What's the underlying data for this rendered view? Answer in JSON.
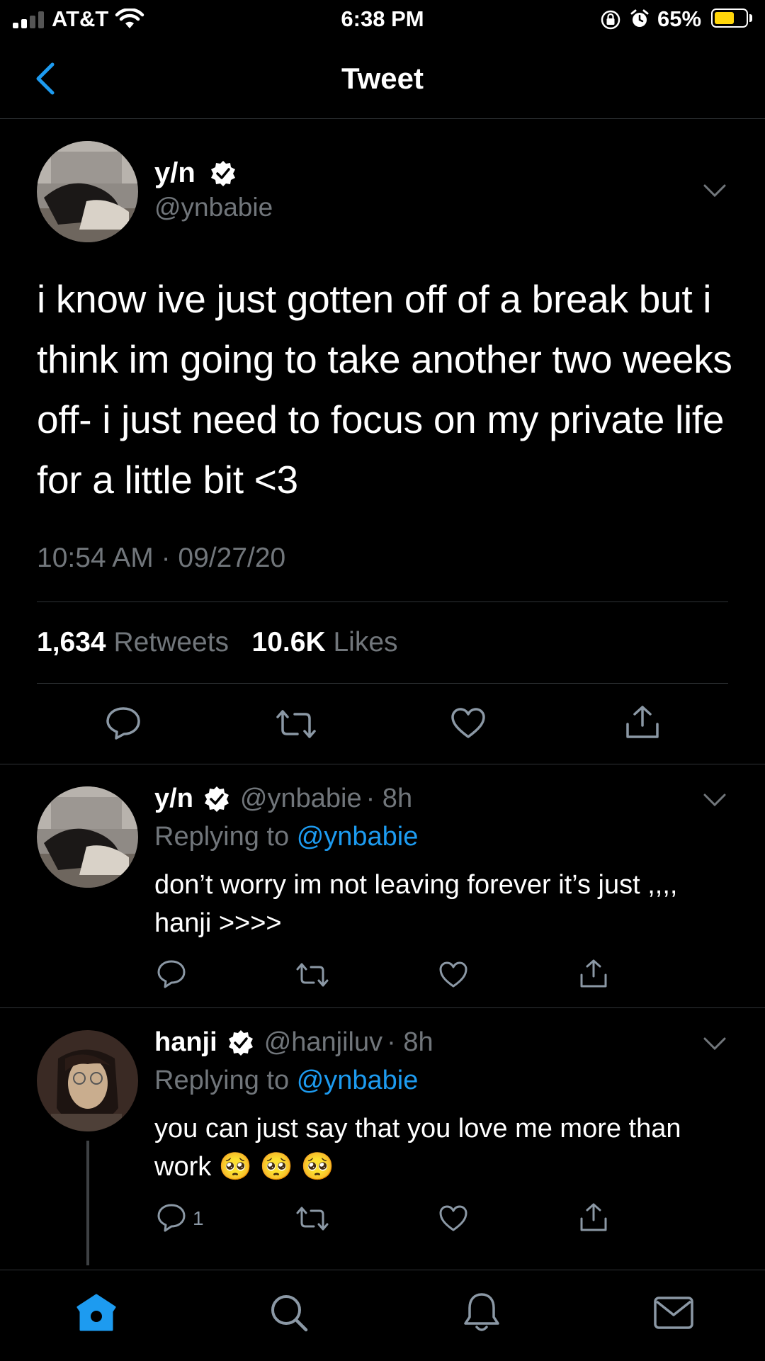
{
  "status_bar": {
    "carrier": "AT&T",
    "time": "6:38 PM",
    "battery_percent": "65%",
    "battery_level": 0.65,
    "battery_color": "#ffd60a"
  },
  "header": {
    "title": "Tweet",
    "back_icon": "chevron-left-icon"
  },
  "main_tweet": {
    "name": "y/n",
    "handle": "@ynbabie",
    "text": "i know ive just gotten off of a break but i think im going to take another two weeks off- i just need to focus on my private life for a little bit <3",
    "timestamp": "10:54 AM · 09/27/20",
    "retweets_count": "1,634",
    "retweets_label": "Retweets",
    "likes_count": "10.6K",
    "likes_label": "Likes"
  },
  "replies": [
    {
      "name": "y/n",
      "handle": "@ynbabie",
      "time": "· 8h",
      "replying_label": "Replying to",
      "replying_to": "@ynbabie",
      "text": "don’t worry im not leaving forever it’s just ,,,, hanji >>>>",
      "reply_count": ""
    },
    {
      "name": "hanji",
      "handle": "@hanjiluv",
      "time": "· 8h",
      "replying_label": "Replying to",
      "replying_to": "@ynbabie",
      "text": "you can just say that you love me more than work 🥺 🥺 🥺",
      "reply_count": "1"
    }
  ],
  "tab_bar": {
    "items": [
      "home-icon",
      "search-icon",
      "notifications-icon",
      "messages-icon"
    ]
  },
  "colors": {
    "background": "#000000",
    "accent": "#1d9bf0",
    "secondary_text": "#71767b",
    "divider": "#2f3336"
  }
}
